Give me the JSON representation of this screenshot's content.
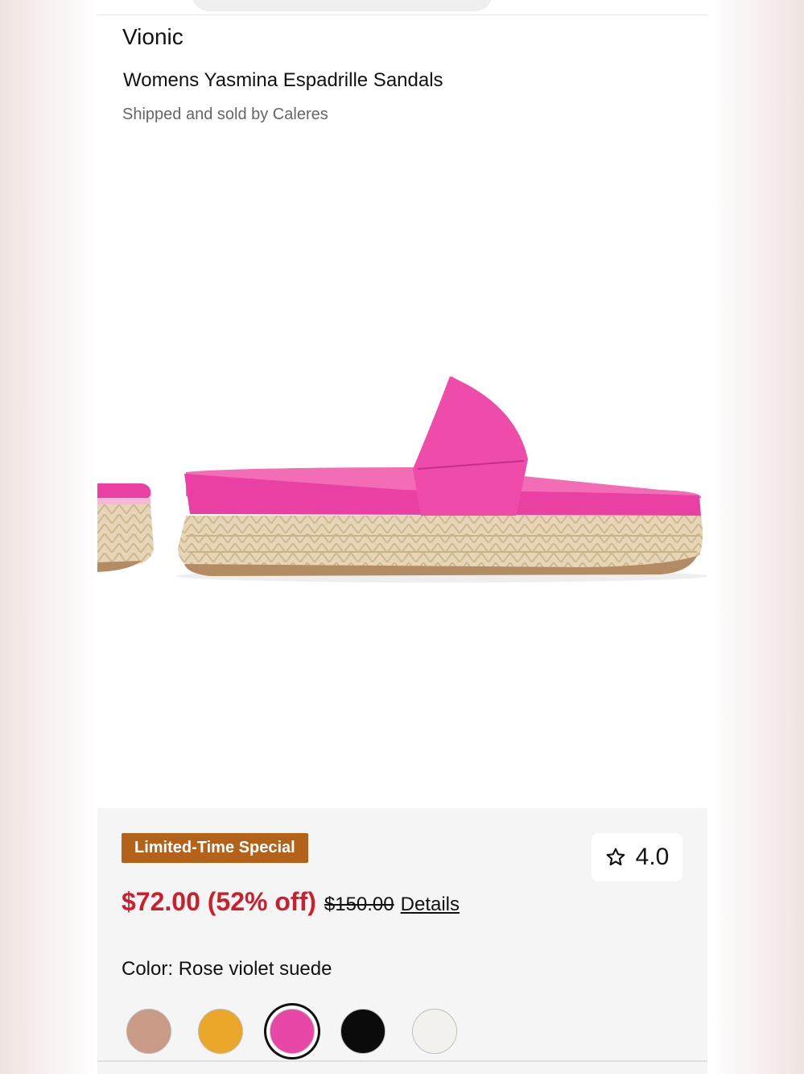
{
  "product": {
    "brand": "Vionic",
    "title": "Womens Yasmina Espadrille Sandals",
    "seller": "Shipped and sold by Caleres"
  },
  "image": {
    "icon": "sandal-product-image"
  },
  "promo": {
    "badge": "Limited-Time Special",
    "badge_color": "#b4621a"
  },
  "rating": {
    "value": "4.0",
    "icon": "star-outline-icon"
  },
  "pricing": {
    "price_text": "$72.00 (52% off)",
    "original_price": "$150.00",
    "details_link": "Details",
    "price_color": "#cc1f2d"
  },
  "color": {
    "label": "Color: Rose violet suede",
    "swatches": [
      {
        "name": "rose-gold",
        "hex": "#c99a86",
        "selected": false
      },
      {
        "name": "yellow",
        "hex": "#eaa72a",
        "selected": false
      },
      {
        "name": "rose-violet",
        "hex": "#e947a8",
        "selected": true
      },
      {
        "name": "black",
        "hex": "#0b0b0b",
        "selected": false
      },
      {
        "name": "white",
        "hex": "#f3f1ee",
        "selected": false
      }
    ]
  }
}
